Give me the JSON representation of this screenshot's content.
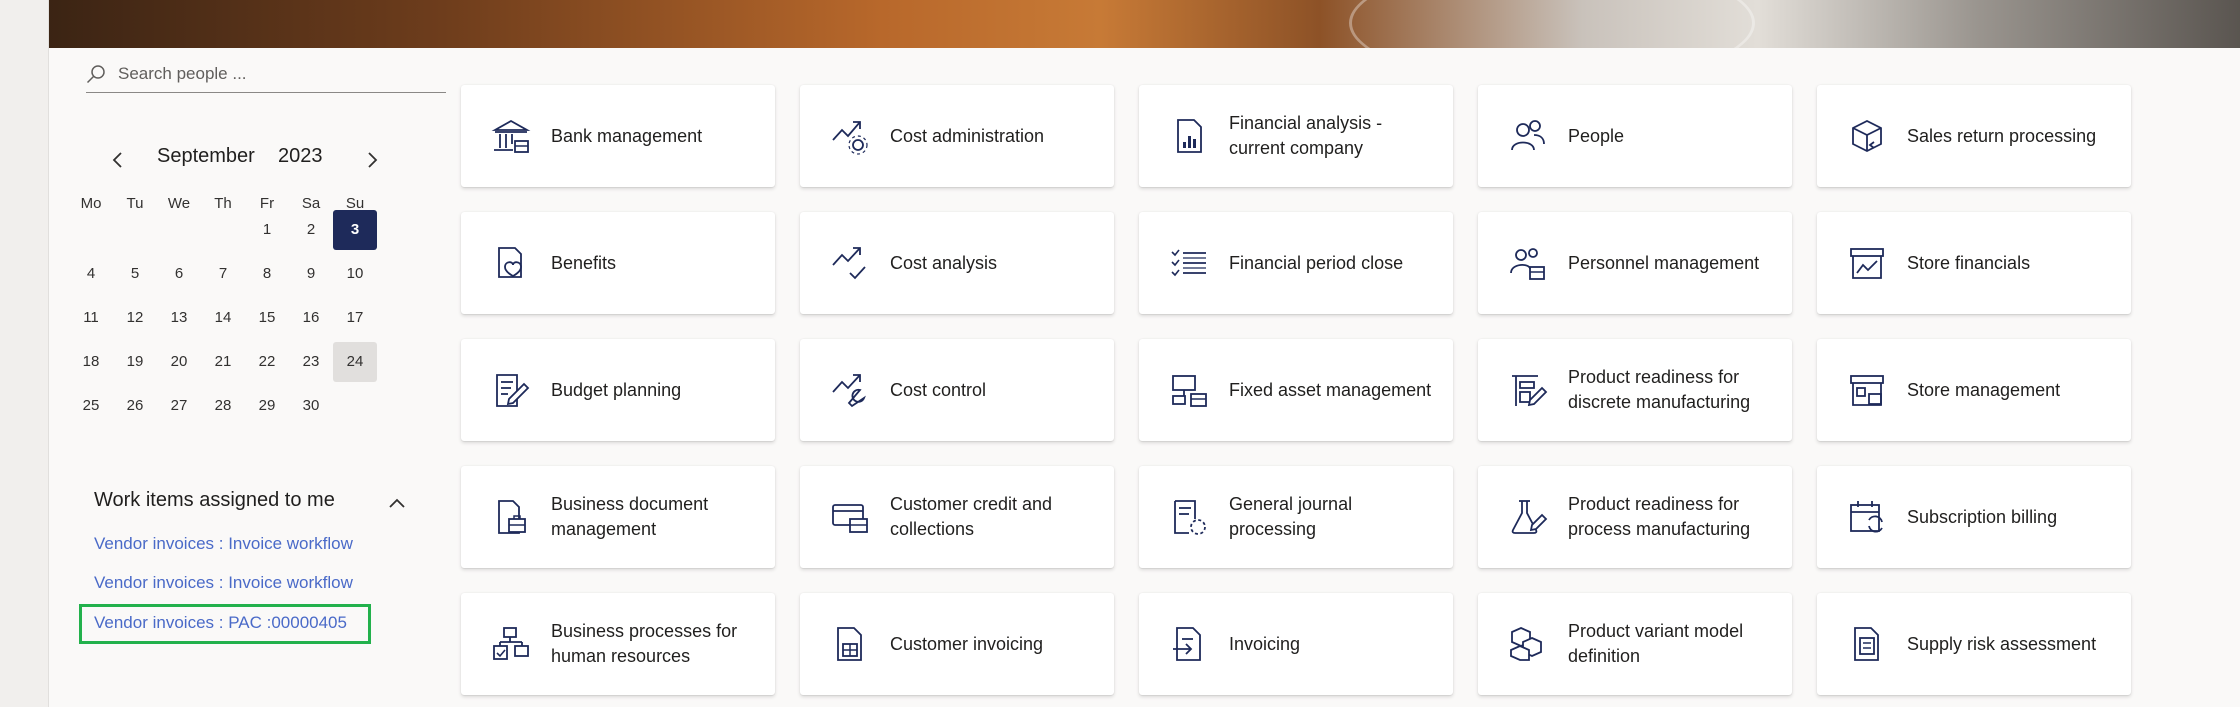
{
  "search": {
    "placeholder": "Search people ..."
  },
  "calendar": {
    "month": "September",
    "year": "2023",
    "weekdays": [
      "Mo",
      "Tu",
      "We",
      "Th",
      "Fr",
      "Sa",
      "Su"
    ],
    "rows": [
      [
        "",
        "",
        "",
        "",
        "1",
        "2",
        "3"
      ],
      [
        "4",
        "5",
        "6",
        "7",
        "8",
        "9",
        "10"
      ],
      [
        "11",
        "12",
        "13",
        "14",
        "15",
        "16",
        "17"
      ],
      [
        "18",
        "19",
        "20",
        "21",
        "22",
        "23",
        "24"
      ],
      [
        "25",
        "26",
        "27",
        "28",
        "29",
        "30",
        ""
      ]
    ],
    "selected_day": "3",
    "hovered_day": "24"
  },
  "work_items": {
    "title": "Work items assigned to me",
    "items": [
      "Vendor invoices : Invoice workflow",
      "Vendor invoices : Invoice workflow",
      "Vendor invoices : PAC  :00000405"
    ]
  },
  "tiles": [
    [
      {
        "label": "Bank management",
        "icon": "bank-icon"
      },
      {
        "label": "Cost administration",
        "icon": "trend-gear-icon"
      },
      {
        "label": "Financial analysis - current company",
        "icon": "report-chart-icon"
      },
      {
        "label": "People",
        "icon": "people-icon"
      },
      {
        "label": "Sales return processing",
        "icon": "box-return-icon"
      }
    ],
    [
      {
        "label": "Benefits",
        "icon": "benefits-icon"
      },
      {
        "label": "Cost analysis",
        "icon": "trend-check-icon"
      },
      {
        "label": "Financial period close",
        "icon": "checklist-icon"
      },
      {
        "label": "Personnel management",
        "icon": "personnel-icon"
      },
      {
        "label": "Store financials",
        "icon": "store-chart-icon"
      }
    ],
    [
      {
        "label": "Budget planning",
        "icon": "budget-icon"
      },
      {
        "label": "Cost control",
        "icon": "trend-wrench-icon"
      },
      {
        "label": "Fixed asset management",
        "icon": "asset-icon"
      },
      {
        "label": "Product readiness for discrete manufacturing",
        "icon": "discrete-mfg-icon"
      },
      {
        "label": "Store management",
        "icon": "store-icon"
      }
    ],
    [
      {
        "label": "Business document management",
        "icon": "document-briefcase-icon"
      },
      {
        "label": "Customer credit and collections",
        "icon": "card-briefcase-icon"
      },
      {
        "label": "General journal processing",
        "icon": "journal-icon"
      },
      {
        "label": "Product readiness for process manufacturing",
        "icon": "flask-icon"
      },
      {
        "label": "Subscription billing",
        "icon": "calendar-sync-icon"
      }
    ],
    [
      {
        "label": "Business processes for human resources",
        "icon": "process-flow-icon"
      },
      {
        "label": "Customer invoicing",
        "icon": "invoice-icon"
      },
      {
        "label": "Invoicing",
        "icon": "invoice-arrow-icon"
      },
      {
        "label": "Product variant model definition",
        "icon": "cubes-icon"
      },
      {
        "label": "Supply risk assessment",
        "icon": "risk-doc-icon"
      }
    ]
  ],
  "colors": {
    "accent": "#1e2a5a",
    "link": "#4a6ac8",
    "highlight_box": "#22b14c",
    "background": "#faf9f8"
  }
}
